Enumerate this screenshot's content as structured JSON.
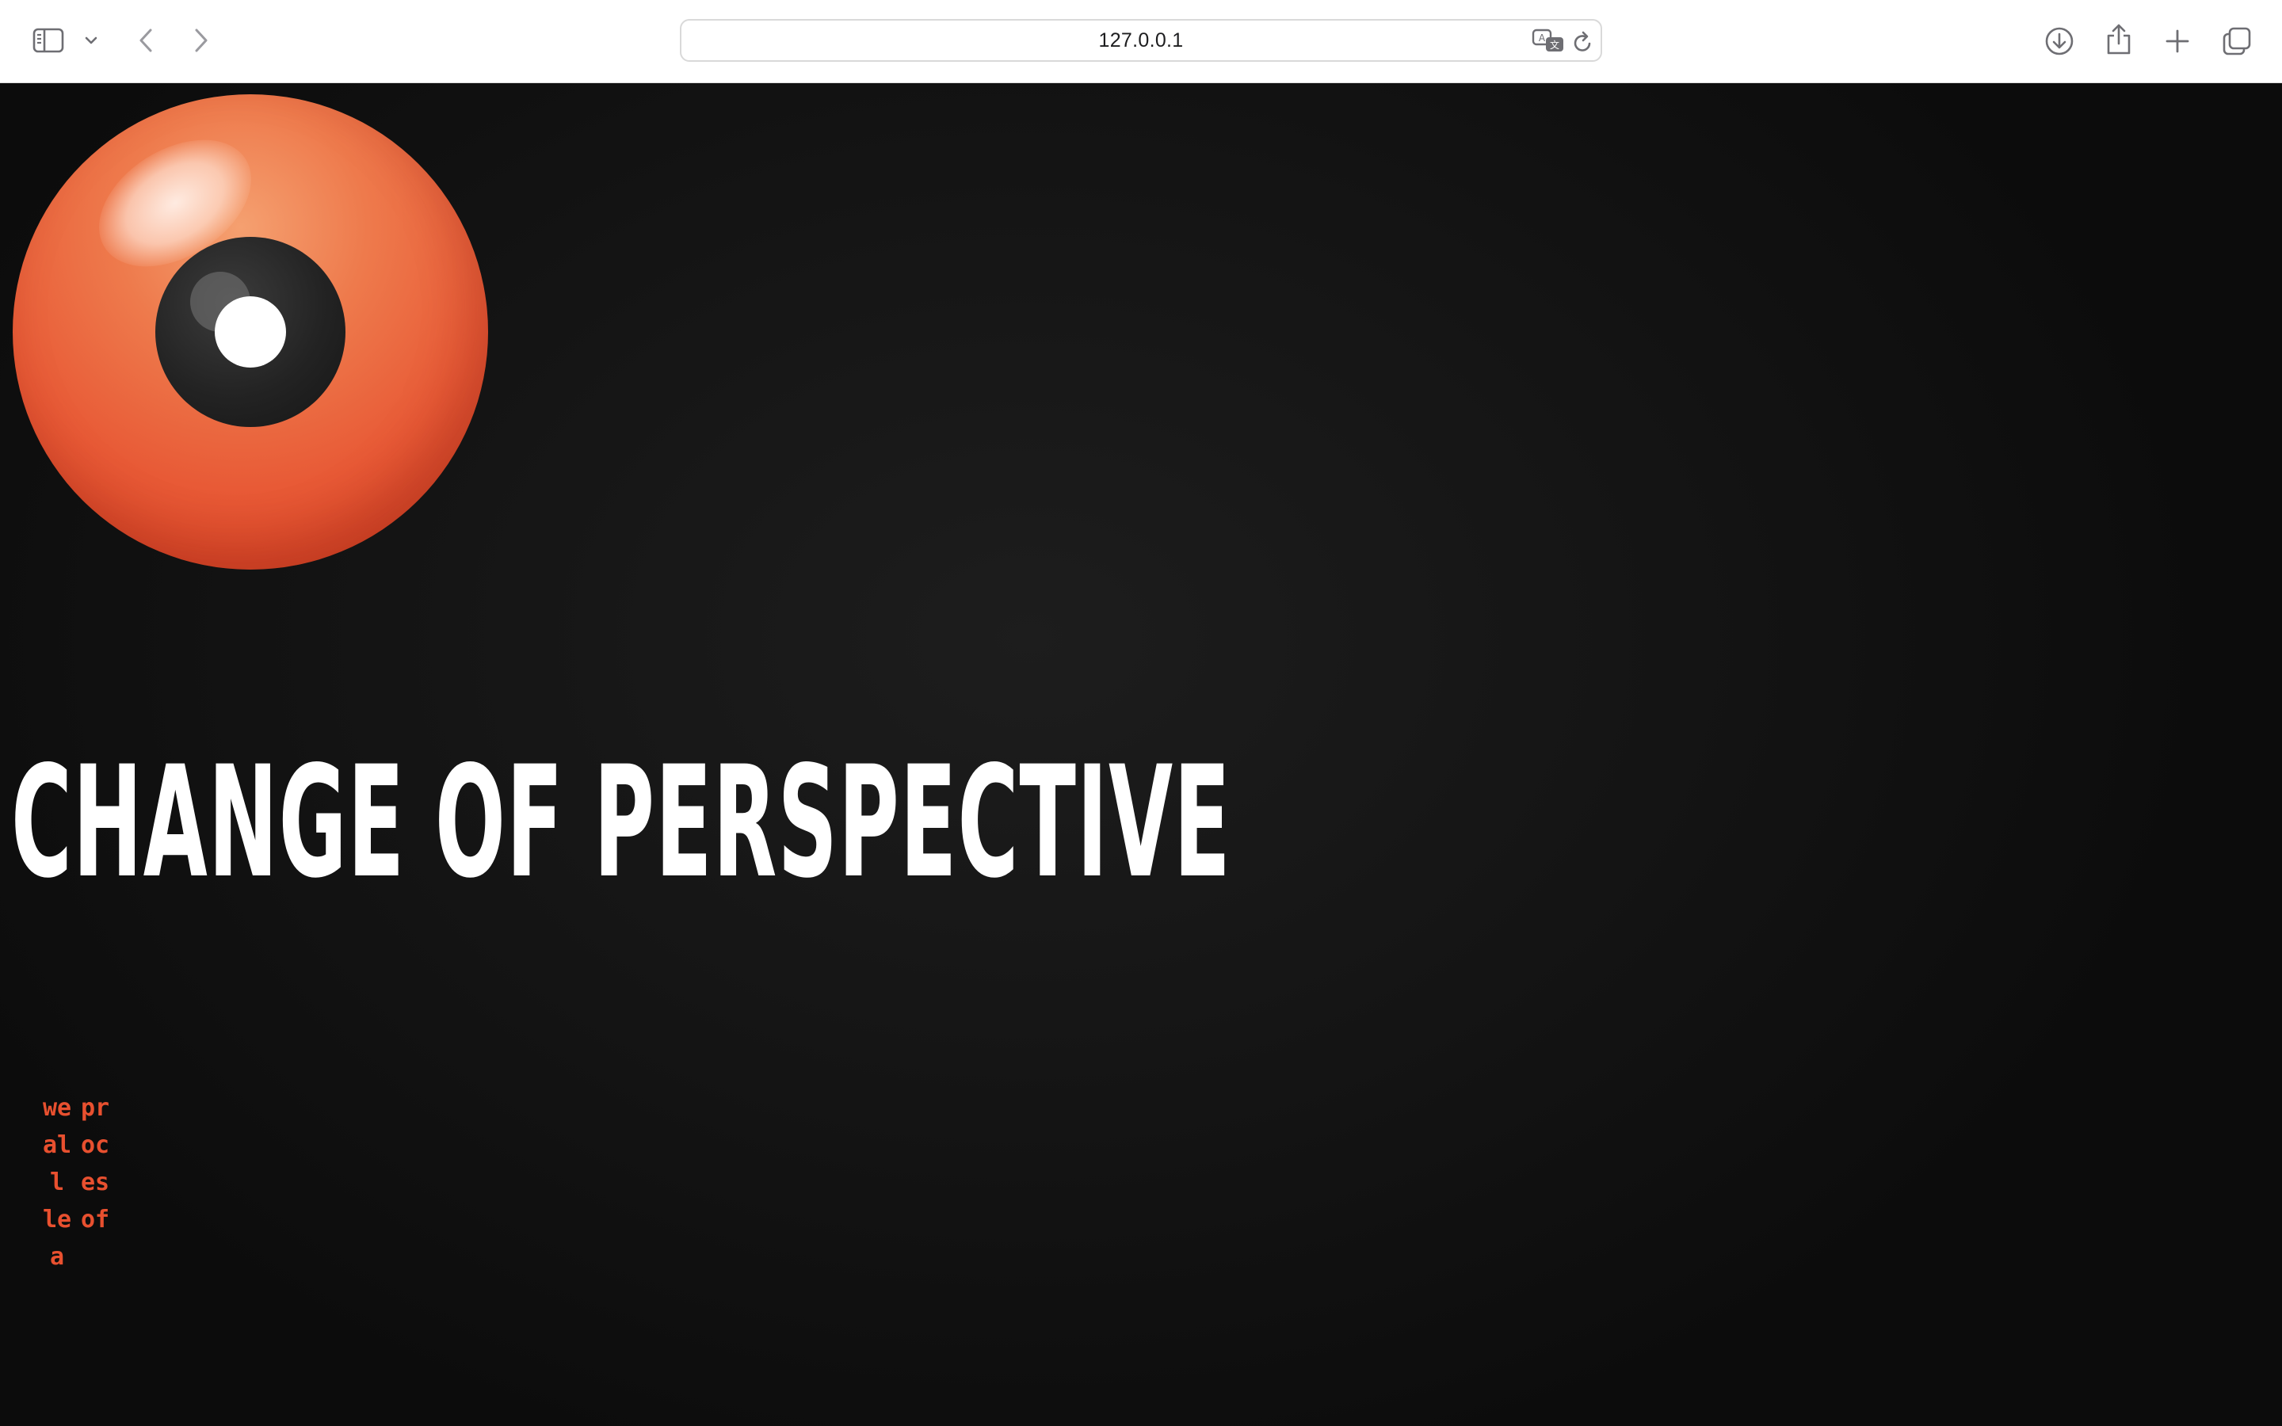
{
  "browser": {
    "url": "127.0.0.1",
    "icons": {
      "sidebar": "sidebar-icon",
      "sidebar_menu": "chevron-down-icon",
      "back": "chevron-left-icon",
      "forward": "chevron-right-icon",
      "translate": "translate-icon",
      "reload": "reload-icon",
      "downloads": "download-icon",
      "share": "share-icon",
      "new_tab": "plus-icon",
      "tab_overview": "tabs-icon"
    }
  },
  "page": {
    "headline": "CHANGE OF PERSPECTIVE",
    "vertical_text": {
      "column_1": "we all lea",
      "column_2": "proces of"
    },
    "colors": {
      "accent": "#e8502f",
      "background": "#111111",
      "headline": "#ffffff"
    }
  }
}
